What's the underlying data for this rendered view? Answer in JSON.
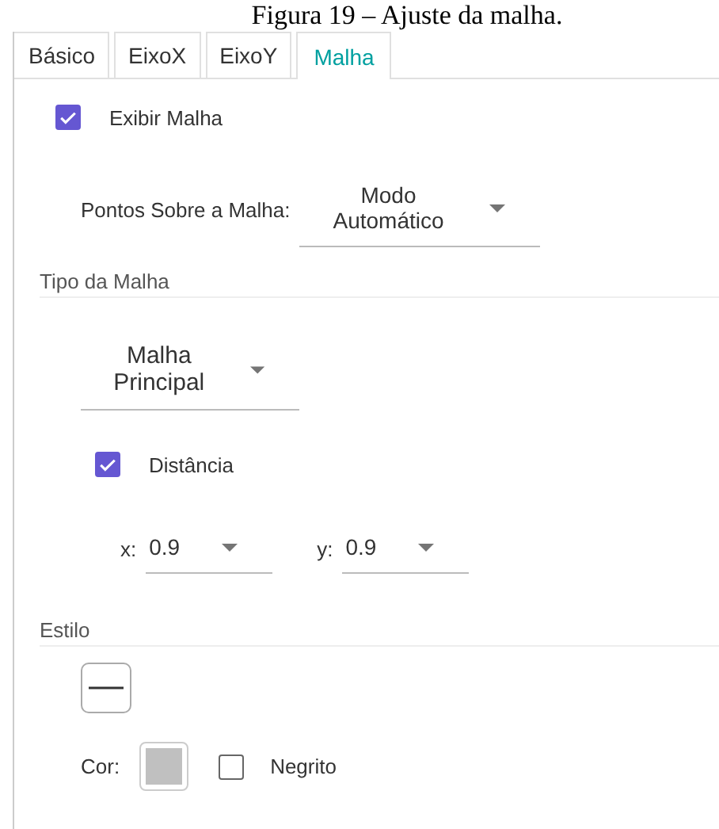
{
  "caption": "Figura 19 – Ajuste da malha.",
  "tabs": [
    {
      "label": "Básico",
      "selected": false
    },
    {
      "label": "EixoX",
      "selected": false
    },
    {
      "label": "EixoY",
      "selected": false
    },
    {
      "label": "Malha",
      "selected": true
    }
  ],
  "show_grid": {
    "label": "Exibir Malha",
    "checked": true
  },
  "snap": {
    "label": "Pontos Sobre a Malha:",
    "value": "Modo Automático"
  },
  "grid_type": {
    "heading": "Tipo da Malha",
    "value": "Malha Principal",
    "distance": {
      "label": "Distância",
      "checked": true
    },
    "x": {
      "label": "x:",
      "value": "0.9"
    },
    "y": {
      "label": "y:",
      "value": "0.9"
    }
  },
  "style": {
    "heading": "Estilo",
    "color_label": "Cor:",
    "color": "#c0c0c0",
    "bold": {
      "label": "Negrito",
      "checked": false
    }
  }
}
